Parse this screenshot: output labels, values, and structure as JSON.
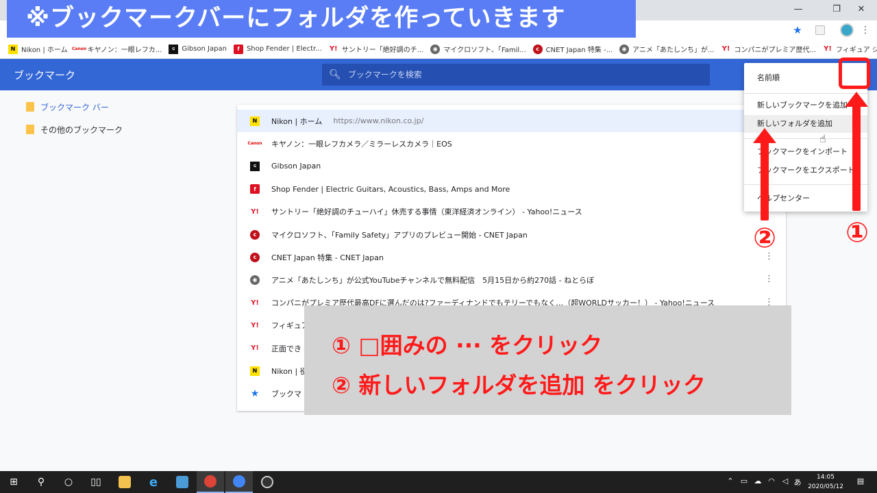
{
  "banner": {
    "text": "※ブックマークバーにフォルダを作っていきます"
  },
  "window": {
    "minimize": "—",
    "maximize": "❐",
    "close": "✕"
  },
  "bookmarks_bar": [
    {
      "label": "Nikon | ホーム",
      "icon": "nikon"
    },
    {
      "label": "キヤノン：一眼レフカ...",
      "icon": "canon"
    },
    {
      "label": "Gibson Japan",
      "icon": "gibson"
    },
    {
      "label": "Shop Fender | Electr...",
      "icon": "fender"
    },
    {
      "label": "サントリー「絶好調のチ...",
      "icon": "yahoo"
    },
    {
      "label": "マイクロソフト、「Famil...",
      "icon": "globe"
    },
    {
      "label": "CNET Japan 特集 -...",
      "icon": "cnet"
    },
    {
      "label": "アニメ「あたしンち」が...",
      "icon": "globe"
    },
    {
      "label": "コンパニがプレミア歴代...",
      "icon": "yahoo"
    },
    {
      "label": "フィギュア ジャンプ採...",
      "icon": "yahoo"
    }
  ],
  "header": {
    "title": "ブックマーク",
    "search_placeholder": "ブックマークを検索",
    "menu_glyph": "⋮"
  },
  "tree": [
    {
      "label": "ブックマーク バー",
      "selected": true
    },
    {
      "label": "その他のブックマーク",
      "selected": false
    }
  ],
  "list": [
    {
      "title": "Nikon | ホーム",
      "url": "https://www.nikon.co.jp/",
      "icon": "nikon"
    },
    {
      "title": "キヤノン：一眼レフカメラ／ミラーレスカメラ｜EOS",
      "url": "",
      "icon": "canon"
    },
    {
      "title": "Gibson Japan",
      "url": "",
      "icon": "gibson"
    },
    {
      "title": "Shop Fender | Electric Guitars, Acoustics, Bass, Amps and More",
      "url": "",
      "icon": "fender"
    },
    {
      "title": "サントリー「絶好調のチューハイ」休売する事情（東洋経済オンライン） - Yahoo!ニュース",
      "url": "",
      "icon": "yahoo"
    },
    {
      "title": "マイクロソフト、「Family Safety」アプリのプレビュー開始 - CNET Japan",
      "url": "",
      "icon": "cnet"
    },
    {
      "title": "CNET Japan 特集 - CNET Japan",
      "url": "",
      "icon": "cnet"
    },
    {
      "title": "アニメ「あたしンち」が公式YouTubeチャンネルで無料配信　5月15日から約270話 - ねとらぼ",
      "url": "",
      "icon": "globe"
    },
    {
      "title": "コンパニがプレミア歴代最高DFに選んだのは?ファーディナンドでもテリーでもなく…（超WORLDサッカー！） - Yahoo!ニュース",
      "url": "",
      "icon": "yahoo"
    },
    {
      "title": "フィギュア",
      "url": "",
      "icon": "yahoo"
    },
    {
      "title": "正面でき",
      "url": "",
      "icon": "yahoo"
    },
    {
      "title": "Nikon | 役",
      "url": "",
      "icon": "nikon"
    },
    {
      "title": "ブックマ",
      "url": "",
      "icon": "star"
    }
  ],
  "row_more_glyph": "⋮",
  "dropdown": {
    "items": [
      "名前順",
      "新しいブックマークを追加",
      "新しいフォルダを追加",
      "ブックマークをインポート",
      "ブックマークをエクスポート",
      "ヘルプセンター"
    ],
    "hovered": "新しいフォルダを追加"
  },
  "annotations": {
    "num1": "①",
    "num2": "②",
    "line1": "① □囲みの ··· をクリック",
    "line2": "② 新しいフォルダを追加 をクリック",
    "accent": "#ff1a1a"
  },
  "taskbar": {
    "time": "14:05",
    "date": "2020/05/12"
  }
}
